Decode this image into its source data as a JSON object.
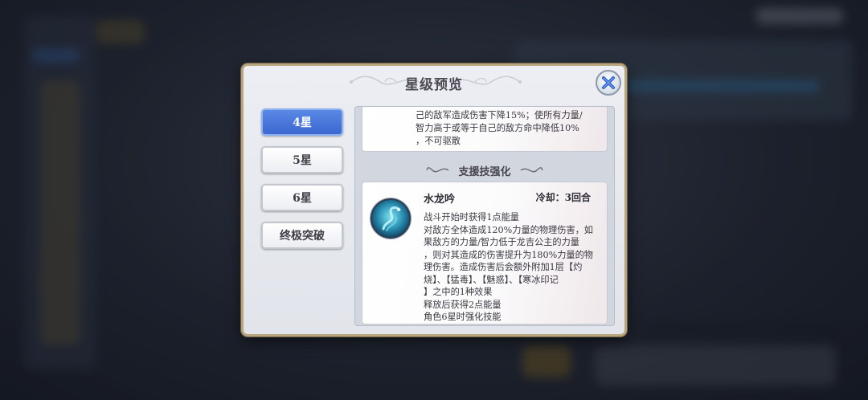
{
  "dialog": {
    "title": "星级预览",
    "close_icon": "close-x-icon"
  },
  "tabs": [
    {
      "label": "4星",
      "active": true
    },
    {
      "label": "5星",
      "active": false
    },
    {
      "label": "6星",
      "active": false
    },
    {
      "label": "终极突破",
      "active": false
    }
  ],
  "previous_skill": {
    "lines": [
      "己的敌军造成伤害下降15%；使所有力量/",
      "智力高于或等于自己的敌方命中降低10%",
      "，不可驱散"
    ]
  },
  "section": {
    "title": "支援技强化"
  },
  "skill": {
    "icon": "water-dragon-skill-icon",
    "name": "水龙吟",
    "cooldown": "冷却：3回合",
    "lines": [
      "战斗开始时获得1点能量",
      "对敌方全体造成120%力量的物理伤害，如",
      "果敌方的力量/智力低于龙吉公主的力量",
      "，则对其造成的伤害提升为180%力量的物",
      "理伤害。造成伤害后会额外附加1层【灼",
      "烧】、【猛毒】、【魅惑】、【寒冰印记",
      "】之中的1种效果",
      "释放后获得2点能量",
      "角色6星时强化技能"
    ]
  },
  "colors": {
    "active_tab": "#4a78dc",
    "frame_gold": "#b9a57c"
  }
}
